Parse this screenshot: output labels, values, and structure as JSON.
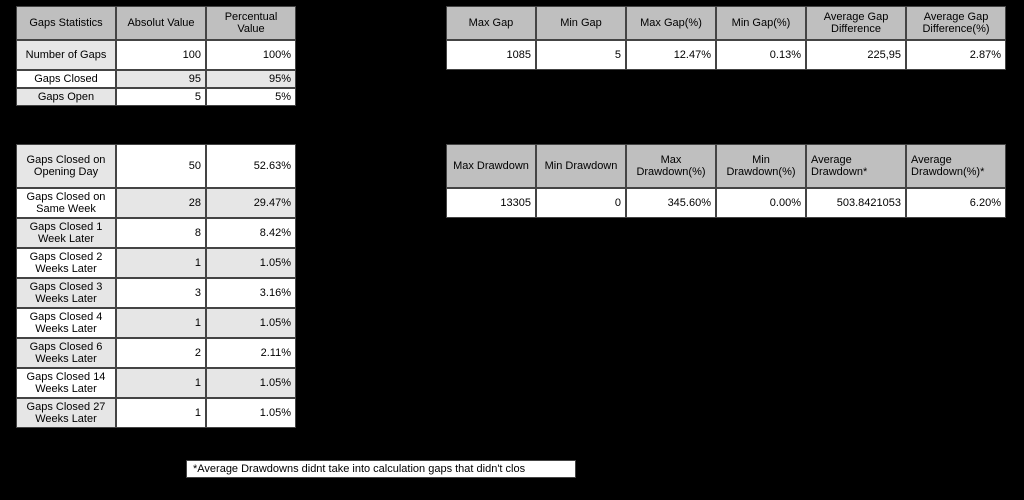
{
  "left": {
    "headers": [
      "Gaps Statistics",
      "Absolut Value",
      "Percentual Value"
    ],
    "top": [
      {
        "label": "Number of Gaps",
        "abs": "100",
        "pct": "100%"
      },
      {
        "label": "Gaps Closed",
        "abs": "95",
        "pct": "95%"
      },
      {
        "label": "Gaps Open",
        "abs": "5",
        "pct": "5%"
      }
    ],
    "detail": [
      {
        "label": "Gaps Closed on Opening Day",
        "abs": "50",
        "pct": "52.63%"
      },
      {
        "label": "Gaps Closed on Same Week",
        "abs": "28",
        "pct": "29.47%"
      },
      {
        "label": "Gaps Closed 1 Week Later",
        "abs": "8",
        "pct": "8.42%"
      },
      {
        "label": "Gaps Closed 2 Weeks Later",
        "abs": "1",
        "pct": "1.05%"
      },
      {
        "label": "Gaps Closed 3 Weeks Later",
        "abs": "3",
        "pct": "3.16%"
      },
      {
        "label": "Gaps Closed 4 Weeks Later",
        "abs": "1",
        "pct": "1.05%"
      },
      {
        "label": "Gaps Closed 6 Weeks Later",
        "abs": "2",
        "pct": "2.11%"
      },
      {
        "label": "Gaps Closed 14 Weeks Later",
        "abs": "1",
        "pct": "1.05%"
      },
      {
        "label": "Gaps Closed 27 Weeks Later",
        "abs": "1",
        "pct": "1.05%"
      }
    ]
  },
  "gap": {
    "headers": [
      "Max Gap",
      "Min Gap",
      "Max Gap(%)",
      "Min Gap(%)",
      "Average Gap Difference",
      "Average Gap Difference(%)"
    ],
    "row": [
      "1085",
      "5",
      "12.47%",
      "0.13%",
      "225,95",
      "2.87%"
    ]
  },
  "dd": {
    "headers": [
      "Max Drawdown",
      "Min Drawdown",
      "Max Drawdown(%)",
      "Min Drawdown(%)",
      "Average Drawdown*",
      "Average Drawdown(%)*"
    ],
    "row": [
      "13305",
      "0",
      "345.60%",
      "0.00%",
      "503.8421053",
      "6.20%"
    ]
  },
  "note": "*Average Drawdowns didnt take into calculation gaps that didn't clos"
}
